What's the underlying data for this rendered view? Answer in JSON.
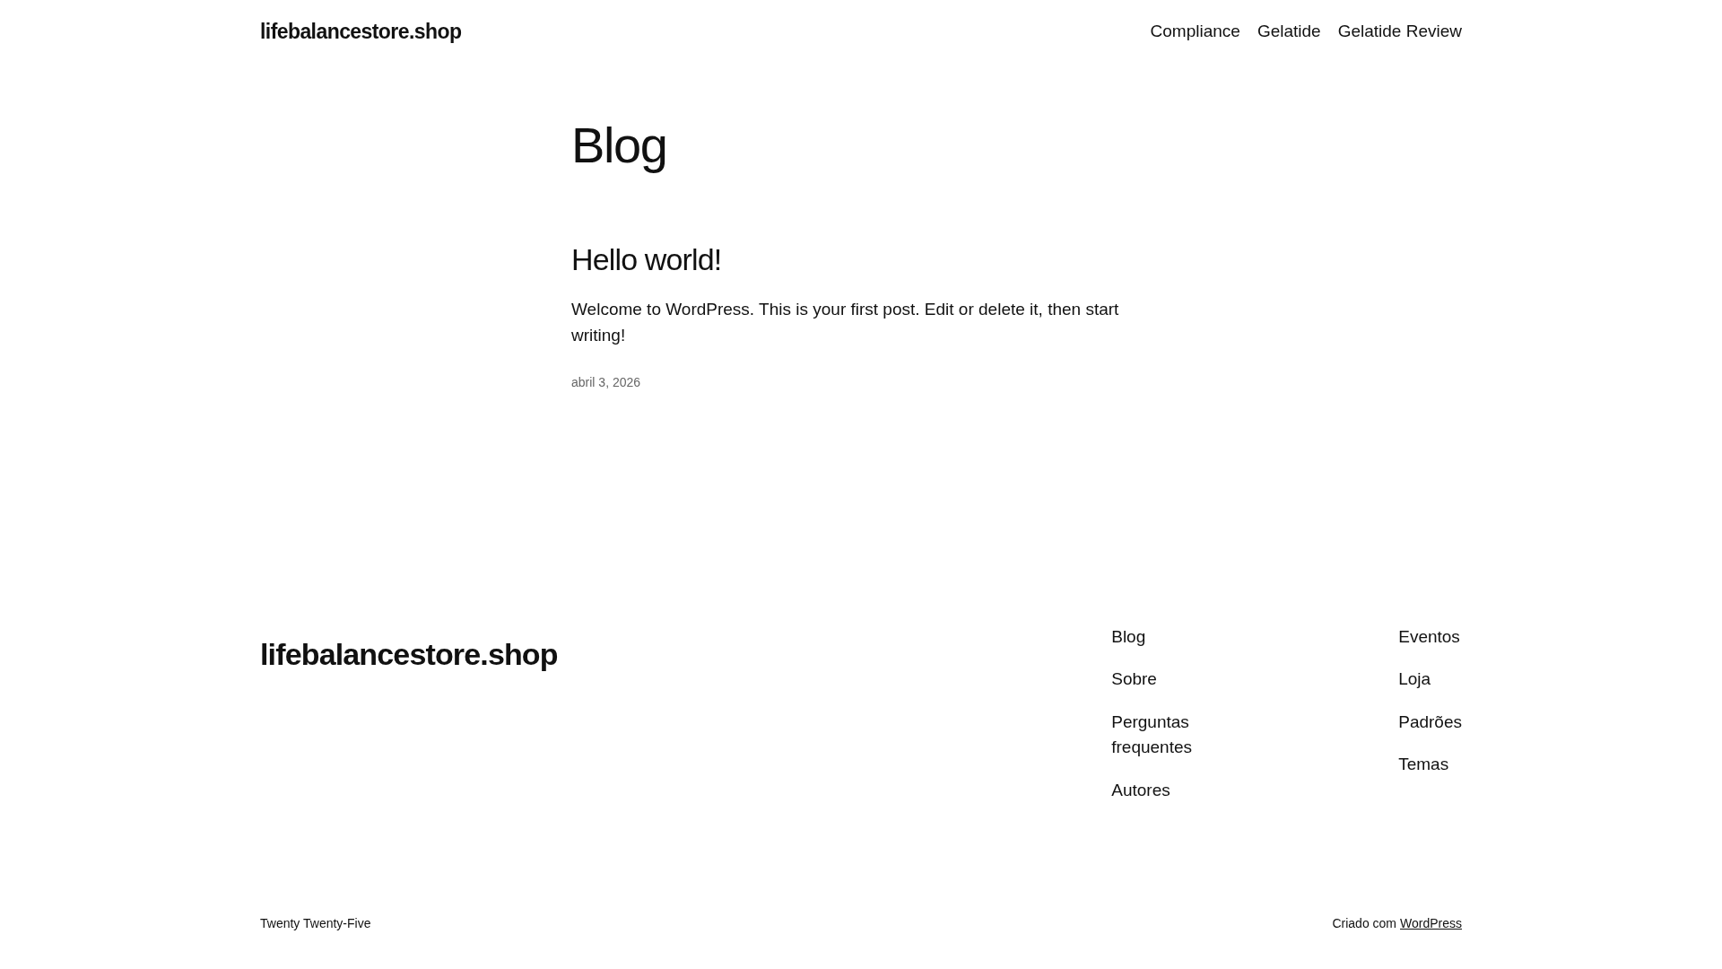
{
  "header": {
    "site_title": "lifebalancestore.shop",
    "nav": [
      "Compliance",
      "Gelatide",
      "Gelatide Review"
    ]
  },
  "page_title": "Blog",
  "posts": [
    {
      "title": "Hello world!",
      "excerpt": "Welcome to WordPress. This is your first post. Edit or delete it, then start writing!",
      "date": "abril 3, 2026"
    }
  ],
  "footer": {
    "site_title": "lifebalancestore.shop",
    "nav_columns": [
      [
        "Blog",
        "Sobre",
        "Perguntas frequentes",
        "Autores"
      ],
      [
        "Eventos",
        "Loja",
        "Padrões",
        "Temas"
      ]
    ],
    "theme_credit": "Twenty Twenty-Five",
    "powered_by": "Criado com",
    "powered_by_link": "WordPress"
  }
}
